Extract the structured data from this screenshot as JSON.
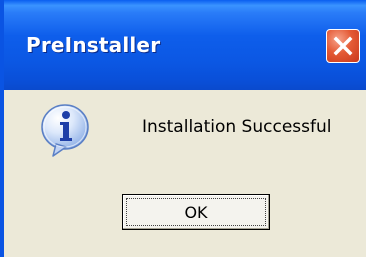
{
  "window": {
    "title": "PreInstaller",
    "accent_color": "#0A54E3",
    "background_color": "#ECE9D8"
  },
  "titlebar": {
    "close_icon": "close-icon"
  },
  "dialog": {
    "icon": "info-icon",
    "message": "Installation Successful",
    "ok_label": "OK"
  }
}
